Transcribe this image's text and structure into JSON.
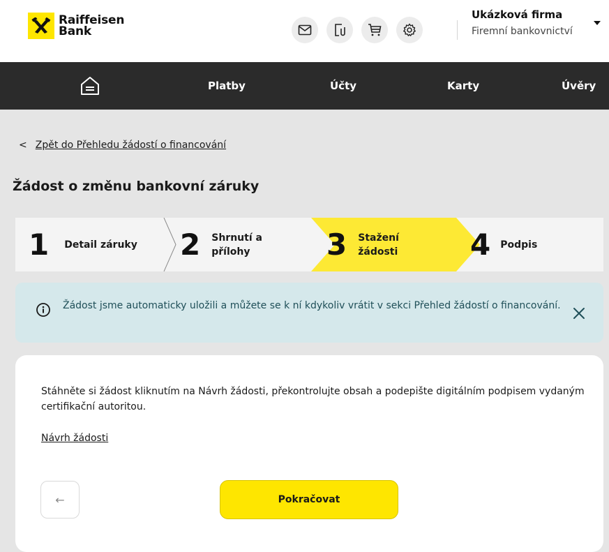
{
  "brand": {
    "line1": "Raiffeisen",
    "line2": "Bank",
    "accent": "#fee600"
  },
  "header": {
    "icons": [
      "mail-icon",
      "document-clip-icon",
      "cart-icon",
      "settings-icon"
    ],
    "company_name": "Ukázková firma",
    "company_sub": "Firemní bankovnictví"
  },
  "nav": {
    "home_icon": "home-icon",
    "items": [
      {
        "label": "Platby"
      },
      {
        "label": "Účty"
      },
      {
        "label": "Karty"
      },
      {
        "label": "Úvěry"
      }
    ]
  },
  "back": {
    "chevron": "<",
    "label": "Zpět do Přehledu žádostí o financování"
  },
  "page_title": "Žádost o změnu bankovní záruky",
  "stepper": {
    "steps": [
      {
        "num": "1",
        "line1": "Detail záruky",
        "line2": ""
      },
      {
        "num": "2",
        "line1": "Shrnutí a",
        "line2": "přílohy"
      },
      {
        "num": "3",
        "line1": "Stažení",
        "line2": "žádosti"
      },
      {
        "num": "4",
        "line1": "Podpis",
        "line2": ""
      }
    ],
    "active_step": 3,
    "active_color": "#fde934"
  },
  "info": {
    "icon": "info-icon",
    "text": "Žádost jsme automaticky uložili a můžete se k ní kdykoliv vrátit v sekci  Přehled žádostí o financování.",
    "close_icon": "close-icon"
  },
  "card": {
    "text": "Stáhněte si žádost kliknutím na Návrh žádosti, překontrolujte obsah a podepište digitálním podpisem vydaným certifikační autoritou.",
    "link": "Návrh žádosti",
    "back_arrow": "←",
    "continue_label": "Pokračovat"
  }
}
